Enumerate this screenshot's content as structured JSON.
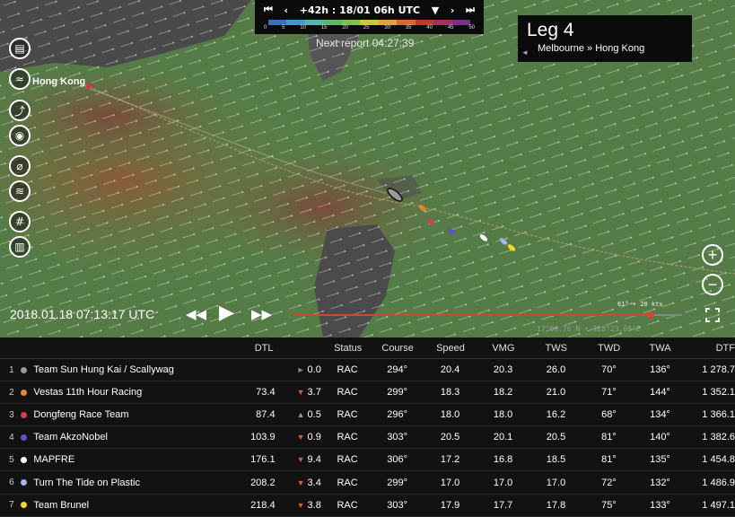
{
  "topbar": {
    "first_icon": "⏮",
    "prev_icon": "‹",
    "forecast_label": "+42h : 18/01 06h UTC",
    "dropdown_icon": "▼",
    "next_icon": "›",
    "last_icon": "⏭",
    "scale_ticks": [
      "0",
      "5",
      "10",
      "15",
      "20",
      "25",
      "30",
      "35",
      "40",
      "45",
      "50"
    ],
    "scale_colors": [
      "#3d6cc4",
      "#3f9bd1",
      "#4fb7b0",
      "#58b86a",
      "#7cc24a",
      "#c8c73a",
      "#e0a23a",
      "#d9682e",
      "#c0392b",
      "#a3305e",
      "#7a2e8a"
    ]
  },
  "next_report": "Next report 04:27:39",
  "leg": {
    "title": "Leg 4",
    "route": "Melbourne » Hong Kong"
  },
  "map": {
    "hong_kong_label": "Hong Kong",
    "wind_readout": "61° • 20 kts",
    "coordinates": "17°00.76'N • 128°23.69'E",
    "timestamp": "2018.01.18 07:13:17 UTC",
    "timeline_progress": 0.985
  },
  "side_icons": [
    "book-icon",
    "wind-icon",
    "track-icon",
    "camera-icon",
    "polar-icon",
    "current-icon",
    "grid-icon",
    "ranking-icon"
  ],
  "table": {
    "headers": {
      "dtl": "DTL",
      "status": "Status",
      "course": "Course",
      "speed": "Speed",
      "vmg": "VMG",
      "tws": "TWS",
      "twd": "TWD",
      "twa": "TWA",
      "dtf": "DTF"
    },
    "rows": [
      {
        "pos": "1",
        "color": "#9a9a9a",
        "name": "Team Sun Hung Kai / Scallywag",
        "dtl": "",
        "arrow": "►",
        "arrow_color": "#888888",
        "delta": "0.0",
        "status": "RAC",
        "course": "294°",
        "speed": "20.4",
        "vmg": "20.3",
        "tws": "26.0",
        "twd": "70°",
        "twa": "136°",
        "dtf": "1 278.7"
      },
      {
        "pos": "2",
        "color": "#e8852e",
        "name": "Vestas 11th Hour Racing",
        "dtl": "73.4",
        "arrow": "▼",
        "arrow_color": "#e05a2a",
        "delta": "3.7",
        "status": "RAC",
        "course": "299°",
        "speed": "18.3",
        "vmg": "18.2",
        "tws": "21.0",
        "twd": "71°",
        "twa": "144°",
        "dtf": "1 352.1"
      },
      {
        "pos": "3",
        "color": "#c8454a",
        "name": "Dongfeng Race Team",
        "dtl": "87.4",
        "arrow": "▲",
        "arrow_color": "#6bbf3a",
        "delta": "0.5",
        "status": "RAC",
        "course": "296°",
        "speed": "18.0",
        "vmg": "18.0",
        "tws": "16.2",
        "twd": "68°",
        "twa": "134°",
        "dtf": "1 366.1"
      },
      {
        "pos": "4",
        "color": "#5a55c8",
        "name": "Team AkzoNobel",
        "dtl": "103.9",
        "arrow": "▼",
        "arrow_color": "#e05a2a",
        "delta": "0.9",
        "status": "RAC",
        "course": "303°",
        "speed": "20.5",
        "vmg": "20.1",
        "tws": "20.5",
        "twd": "81°",
        "twa": "140°",
        "dtf": "1 382.6"
      },
      {
        "pos": "5",
        "color": "#ffffff",
        "name": "MAPFRE",
        "dtl": "176.1",
        "arrow": "▼",
        "arrow_color": "#e05a2a",
        "delta": "9.4",
        "status": "RAC",
        "course": "306°",
        "speed": "17.2",
        "vmg": "16.8",
        "tws": "18.5",
        "twd": "81°",
        "twa": "135°",
        "dtf": "1 454.8"
      },
      {
        "pos": "6",
        "color": "#a7b2e6",
        "name": "Turn The Tide on Plastic",
        "dtl": "208.2",
        "arrow": "▼",
        "arrow_color": "#e05a2a",
        "delta": "3.4",
        "status": "RAC",
        "course": "299°",
        "speed": "17.0",
        "vmg": "17.0",
        "tws": "17.0",
        "twd": "72°",
        "twa": "132°",
        "dtf": "1 486.9"
      },
      {
        "pos": "7",
        "color": "#f0d82a",
        "name": "Team Brunel",
        "dtl": "218.4",
        "arrow": "▼",
        "arrow_color": "#e05a2a",
        "delta": "3.8",
        "status": "RAC",
        "course": "303°",
        "speed": "17.9",
        "vmg": "17.7",
        "tws": "17.8",
        "twd": "75°",
        "twa": "133°",
        "dtf": "1 497.1"
      }
    ]
  }
}
